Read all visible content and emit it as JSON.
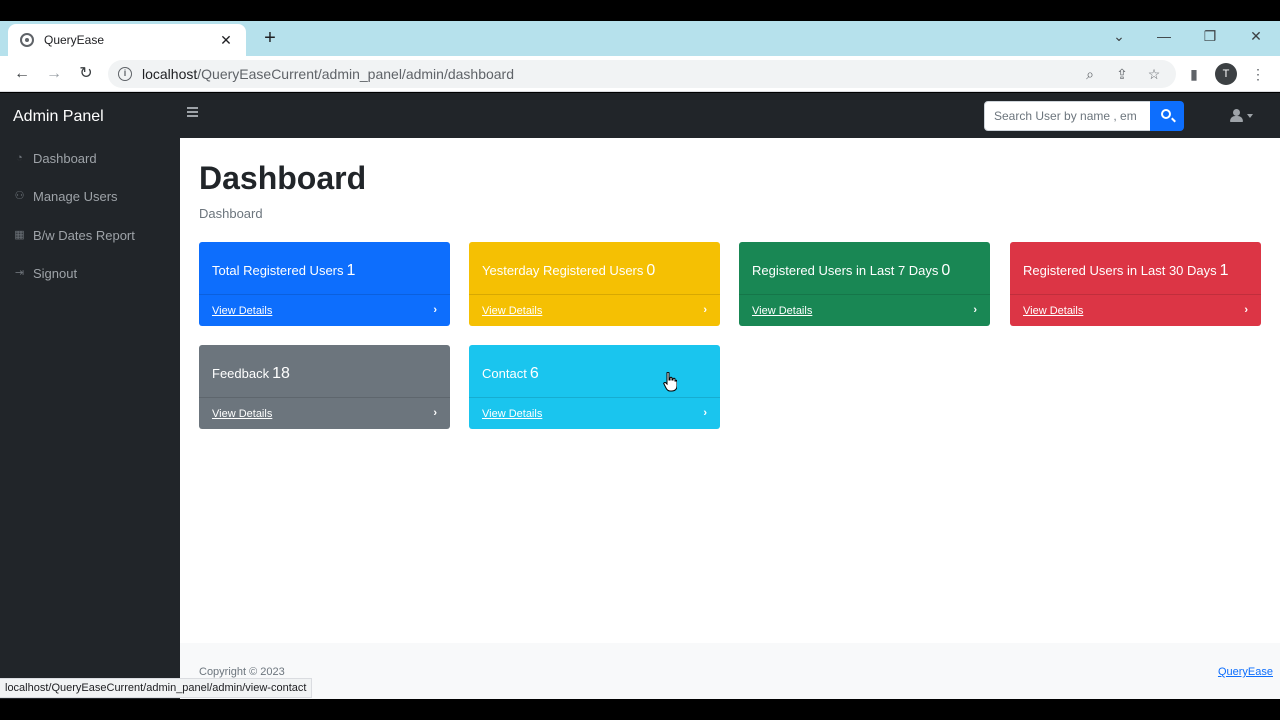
{
  "browser": {
    "tab_title": "QueryEase",
    "url_host": "localhost",
    "url_path": "/QueryEaseCurrent/admin_panel/admin/dashboard",
    "profile_initial": "T",
    "status_url": "localhost/QueryEaseCurrent/admin_panel/admin/view-contact"
  },
  "sidebar": {
    "brand": "Admin Panel",
    "items": [
      {
        "label": "Dashboard",
        "icon": "dashboard-icon"
      },
      {
        "label": "Manage Users",
        "icon": "users-icon"
      },
      {
        "label": "B/w Dates Report",
        "icon": "calendar-icon"
      },
      {
        "label": "Signout",
        "icon": "signout-icon"
      }
    ]
  },
  "topnav": {
    "search_placeholder": "Search User by name , em"
  },
  "main": {
    "title": "Dashboard",
    "breadcrumb": "Dashboard",
    "cards": [
      {
        "label": "Total Registered Users",
        "value": "1",
        "link": "View Details",
        "color": "#0d6efd"
      },
      {
        "label": "Yesterday Registered Users",
        "value": "0",
        "link": "View Details",
        "color": "#f5c003"
      },
      {
        "label": "Registered Users in Last 7 Days",
        "value": "0",
        "link": "View Details",
        "color": "#198754"
      },
      {
        "label": "Registered Users in Last 30 Days",
        "value": "1",
        "link": "View Details",
        "color": "#dc3545"
      },
      {
        "label": "Feedback",
        "value": "18",
        "link": "View Details",
        "color": "#6c757d"
      },
      {
        "label": "Contact",
        "value": "6",
        "link": "View Details",
        "color": "#1ac5ee"
      }
    ]
  },
  "footer": {
    "copyright": "Copyright © 2023",
    "link": "QueryEase"
  }
}
